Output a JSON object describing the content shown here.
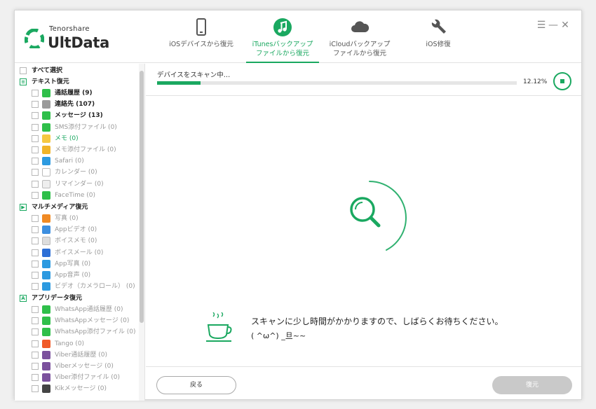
{
  "brand": {
    "small": "Tenorshare",
    "name": "UltData"
  },
  "nav": [
    {
      "line1": "iOSデバイスから復元",
      "line2": "",
      "icon": "iphone-icon",
      "active": false
    },
    {
      "line1": "iTunesバックアップ",
      "line2": "ファイルから復元",
      "icon": "itunes-music-icon",
      "active": true
    },
    {
      "line1": "iCloudバックアップ",
      "line2": "ファイルから復元",
      "icon": "cloud-icon",
      "active": false
    },
    {
      "line1": "iOS修復",
      "line2": "",
      "icon": "wrench-icon",
      "active": false
    }
  ],
  "window_controls": {
    "menu": "☰",
    "minimize": "—",
    "close": "✕"
  },
  "sidebar": {
    "select_all": "すべて選択",
    "categories": {
      "text": "テキスト復元",
      "media": "マルチメディア復元",
      "app": "アプリデータ復元"
    },
    "items": [
      {
        "label": "通話履歴 (9)",
        "icon": "phone-icon",
        "color": "#2fbf4a",
        "state": "bold"
      },
      {
        "label": "連絡先 (107)",
        "icon": "contacts-icon",
        "color": "#9a9a9a",
        "state": "bold"
      },
      {
        "label": "メッセージ (13)",
        "icon": "message-icon",
        "color": "#2fbf4a",
        "state": "bold"
      },
      {
        "label": "SMS添付ファイル (0)",
        "icon": "attachment-icon",
        "color": "#2fbf4a",
        "state": "dim"
      },
      {
        "label": "メモ (0)",
        "icon": "notes-icon",
        "color": "#f5c842",
        "state": "green"
      },
      {
        "label": "メモ添付ファイル (0)",
        "icon": "notes-attachment-icon",
        "color": "#f0b429",
        "state": "dim"
      },
      {
        "label": "Safari (0)",
        "icon": "safari-icon",
        "color": "#2d9ae0",
        "state": "dim"
      },
      {
        "label": "カレンダー (0)",
        "icon": "calendar-icon",
        "color": "#ffffff",
        "state": "dim"
      },
      {
        "label": "リマインダー (0)",
        "icon": "reminder-icon",
        "color": "#eeeeee",
        "state": "dim"
      },
      {
        "label": "FaceTime (0)",
        "icon": "facetime-icon",
        "color": "#2fbf4a",
        "state": "dim"
      },
      {
        "label": "写真 (0)",
        "icon": "photos-icon",
        "color": "#f08a24",
        "state": "dim"
      },
      {
        "label": "Appビデオ (0)",
        "icon": "app-video-icon",
        "color": "#3d8fe0",
        "state": "dim"
      },
      {
        "label": "ボイスメモ (0)",
        "icon": "voice-memo-icon",
        "color": "#dddddd",
        "state": "dim"
      },
      {
        "label": "ボイスメール (0)",
        "icon": "voicemail-icon",
        "color": "#2d6fd6",
        "state": "dim"
      },
      {
        "label": "App写真 (0)",
        "icon": "app-photo-icon",
        "color": "#2d9ae0",
        "state": "dim"
      },
      {
        "label": "App音声 (0)",
        "icon": "app-audio-icon",
        "color": "#2d9ae0",
        "state": "dim"
      },
      {
        "label": "ビデオ（カメラロール） (0)",
        "icon": "camera-roll-video-icon",
        "color": "#2d9ae0",
        "state": "dim"
      },
      {
        "label": "WhatsApp通話履歴 (0)",
        "icon": "whatsapp-call-icon",
        "color": "#2fbf4a",
        "state": "dim"
      },
      {
        "label": "WhatsAppメッセージ (0)",
        "icon": "whatsapp-icon",
        "color": "#2fbf4a",
        "state": "dim"
      },
      {
        "label": "WhatsApp添付ファイル (0)",
        "icon": "whatsapp-attachment-icon",
        "color": "#2fbf4a",
        "state": "dim"
      },
      {
        "label": "Tango (0)",
        "icon": "tango-icon",
        "color": "#f05a28",
        "state": "dim"
      },
      {
        "label": "Viber通話履歴 (0)",
        "icon": "viber-call-icon",
        "color": "#7b519d",
        "state": "dim"
      },
      {
        "label": "Viberメッセージ (0)",
        "icon": "viber-icon",
        "color": "#7b519d",
        "state": "dim"
      },
      {
        "label": "Viber添付ファイル (0)",
        "icon": "viber-attachment-icon",
        "color": "#7b519d",
        "state": "dim"
      },
      {
        "label": "Kikメッセージ (0)",
        "icon": "kik-icon",
        "color": "#444444",
        "state": "dim"
      }
    ]
  },
  "scan": {
    "title": "デバイスをスキャン中…",
    "percent_text": "12.12%",
    "progress": 0.1212
  },
  "wait": {
    "line1": "スキャンに少し時間がかかりますので、しばらくお待ちください。",
    "line2": "( ^ω^) _旦~~"
  },
  "footer": {
    "back": "戻る",
    "recover": "復元"
  },
  "colors": {
    "accent": "#1aa860",
    "disabled": "#c9c9c9"
  }
}
